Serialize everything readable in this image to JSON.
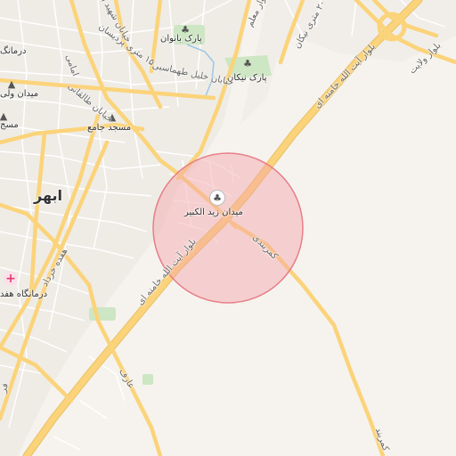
{
  "map": {
    "city_label": "ابهر",
    "center_poi": "میدان زید الکبیر",
    "pois": {
      "park_banovan": "پارک بانوان",
      "park_nikan": "پارک نیکان",
      "masjed_jame": "مسجد جامع",
      "meydan_vali": "میدان ولی",
      "darmangah_top": "درمانگ",
      "masjed_left": "مسج",
      "darmangah_hefdah": "درمانگاه هفد"
    },
    "roads": {
      "khamenei_ne": "بلوار آیت الله خامنه ای",
      "khamenei_sw": "بلوار آیت الله خامنه ای",
      "velayat": "بلوار ولایت",
      "taleghani": "خیابان طالقانی",
      "khalil_tahmasbi": "خیابان خلیل طهماسبی",
      "shahid_bahonar": "خیابان شهید باهنر",
      "pardisan": "۱۵ متری پردیسان",
      "hefdah_khordad": "هفده خرداد",
      "moallem": "بلوار معلم",
      "nikan": "۲۰ متری نیکان",
      "emami": "امامی",
      "kamarbandi_1": "کمربندی",
      "kamarbandi_2": "کمربند",
      "aref": "عارف",
      "faq": "فر"
    },
    "colors": {
      "background": "#f6f3ee",
      "major_road": "#fbd37a",
      "minor_road": "#ffffff",
      "park": "#cde6c3",
      "search_circle": "#f4a3a8",
      "hospital_pin": "#e23a6e"
    }
  }
}
